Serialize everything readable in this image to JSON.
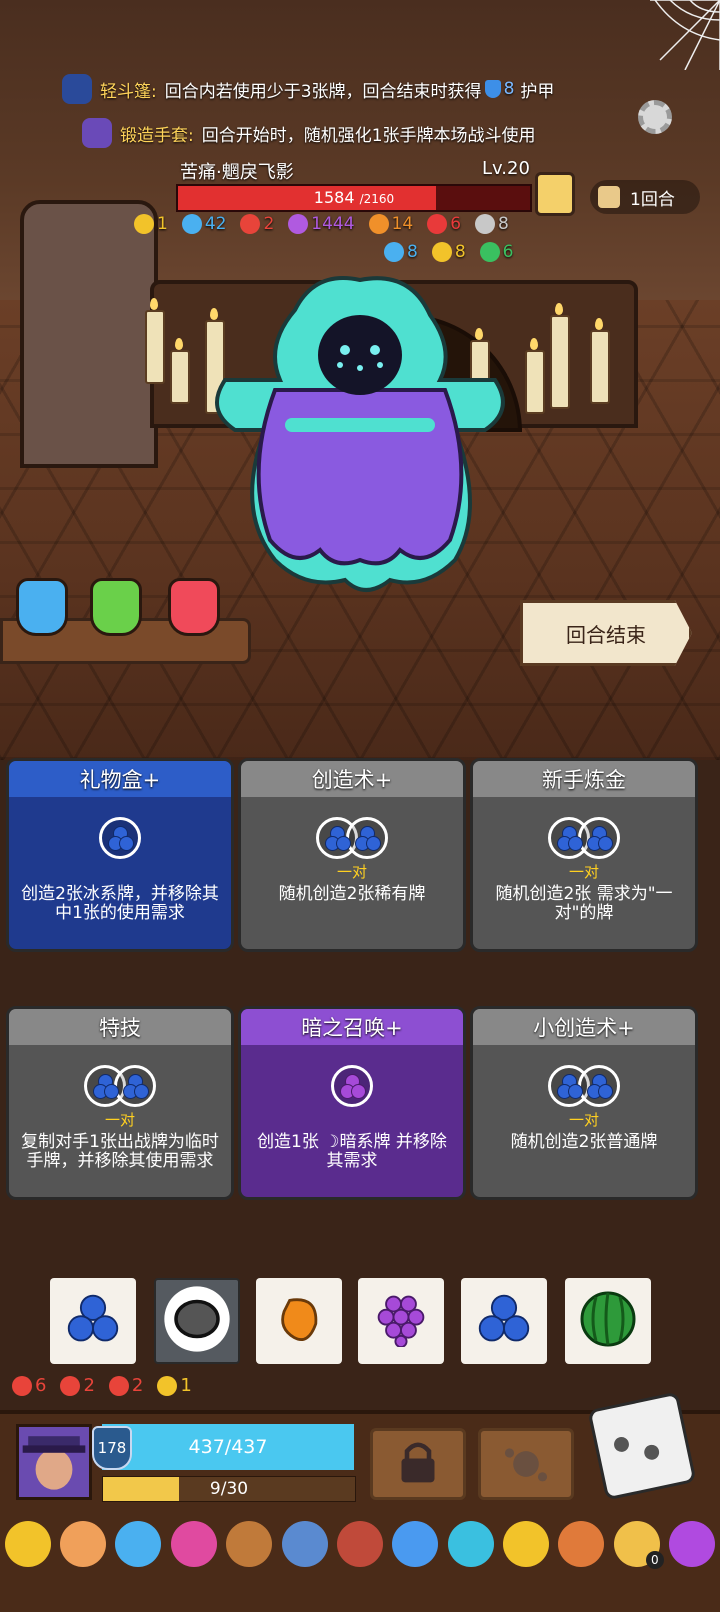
{
  "buffs": [
    {
      "name": "轻斗篷:",
      "text_a": "回合内若使用少于3张牌，回合结束时获得",
      "shield_value": "8",
      "text_b": "护甲"
    },
    {
      "name": "锻造手套:",
      "text_a": "回合开始时，随机强化1张手牌本场战斗使用"
    }
  ],
  "enemy": {
    "name": "苦痛·魍戾飞影",
    "level": "Lv.20",
    "hp_current": "1584",
    "hp_max": "/2160",
    "hp_fraction": 0.733,
    "statuses_row1": [
      {
        "icon": "shield-icon",
        "value": "1",
        "color": "#f2c32a"
      },
      {
        "icon": "frost-icon",
        "value": "42",
        "color": "#4ab0f0"
      },
      {
        "icon": "fire-icon",
        "value": "2",
        "color": "#e8443a"
      },
      {
        "icon": "curse-icon",
        "value": "1444",
        "color": "#b05ae0"
      },
      {
        "icon": "flame-icon",
        "value": "14",
        "color": "#f0902a"
      },
      {
        "icon": "devil-icon",
        "value": "6",
        "color": "#e83a3a"
      },
      {
        "icon": "skull-icon",
        "value": "8",
        "color": "#c8c8c8"
      }
    ],
    "statuses_row2": [
      {
        "icon": "speech-icon",
        "value": "8",
        "color": "#4ab0f0"
      },
      {
        "icon": "lock-icon",
        "value": "8",
        "color": "#f2c32a"
      },
      {
        "icon": "poison-icon",
        "value": "6",
        "color": "#3ac060"
      }
    ]
  },
  "turn": {
    "label": "1回合"
  },
  "end_turn": {
    "label": "回合结束"
  },
  "cards": [
    {
      "title": "礼物盒+",
      "style": "blue",
      "dice": [
        "berry"
      ],
      "req": "",
      "desc": "创造2张冰系牌，并移除其中1张的使用需求"
    },
    {
      "title": "创造术+",
      "style": "gray",
      "dice": [
        "berry",
        "berry"
      ],
      "req": "一对",
      "desc": "随机创造2张稀有牌"
    },
    {
      "title": "新手炼金",
      "style": "gray",
      "dice": [
        "berry",
        "berry"
      ],
      "req": "一对",
      "desc": "随机创造2张 需求为\"一对\"的牌"
    },
    {
      "title": "特技",
      "style": "gray",
      "dice": [
        "berry",
        "berry"
      ],
      "req": "一对",
      "desc": "复制对手1张出战牌为临时手牌，并移除其使用需求"
    },
    {
      "title": "暗之召唤+",
      "style": "purple",
      "dice": [
        "grape"
      ],
      "req": "",
      "desc": "创造1张 ☽暗系牌 并移除其需求"
    },
    {
      "title": "小创造术+",
      "style": "gray",
      "dice": [
        "berry",
        "berry"
      ],
      "req": "一对",
      "desc": "随机创造2张普通牌"
    }
  ],
  "hand": [
    {
      "icon": "blueberry-icon"
    },
    {
      "icon": "stone-icon"
    },
    {
      "icon": "mango-icon"
    },
    {
      "icon": "grape-icon"
    },
    {
      "icon": "blueberry-icon"
    },
    {
      "icon": "watermelon-icon"
    }
  ],
  "player_statuses": [
    {
      "icon": "gear-red-icon",
      "value": "6",
      "color": "#e8443a"
    },
    {
      "icon": "sword-shield-icon",
      "value": "2",
      "color": "#e8443a"
    },
    {
      "icon": "red-shield-icon",
      "value": "2",
      "color": "#e8443a"
    },
    {
      "icon": "gold-shield-icon",
      "value": "1",
      "color": "#f2c32a"
    }
  ],
  "player": {
    "armor": "178",
    "hp": "437/437",
    "xp": "9/30",
    "xp_fraction": 0.3
  },
  "relic_badge": "0"
}
